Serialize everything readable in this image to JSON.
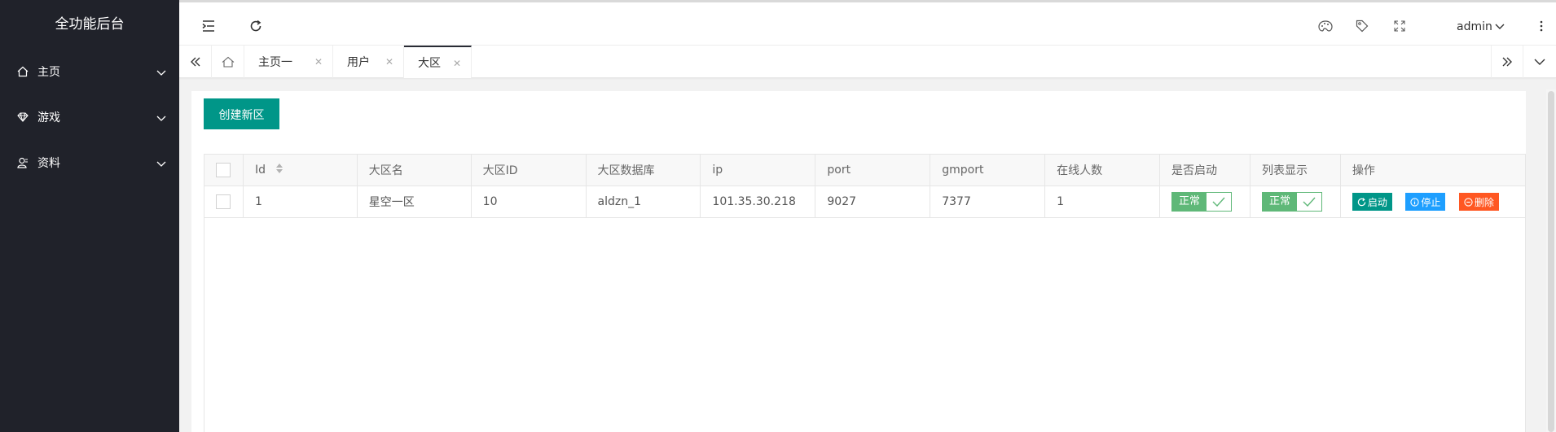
{
  "app": {
    "title": "全功能后台"
  },
  "sidebar": {
    "items": [
      {
        "label": "主页",
        "icon": "home-icon"
      },
      {
        "label": "游戏",
        "icon": "diamond-icon"
      },
      {
        "label": "资料",
        "icon": "user-icon"
      }
    ]
  },
  "header": {
    "user": "admin",
    "icons": [
      "menu-fold-icon",
      "refresh-icon",
      "theme-icon",
      "tag-icon",
      "fullscreen-icon",
      "more-icon"
    ]
  },
  "tabs": {
    "items": [
      {
        "label": "主页一",
        "active": false
      },
      {
        "label": "用户",
        "active": false
      },
      {
        "label": "大区",
        "active": true
      }
    ]
  },
  "toolbar": {
    "create_label": "创建新区"
  },
  "table": {
    "headers": [
      "Id",
      "大区名",
      "大区ID",
      "大区数据库",
      "ip",
      "port",
      "gmport",
      "在线人数",
      "是否启动",
      "列表显示",
      "操作"
    ],
    "rows": [
      {
        "id": "1",
        "name": "星空一区",
        "zone_id": "10",
        "database": "aldzn_1",
        "ip": "101.35.30.218",
        "port": "9027",
        "gmport": "7377",
        "online": "1",
        "enabled_label": "正常",
        "display_label": "正常"
      }
    ],
    "actions": {
      "start_label": "启动",
      "stop_label": "停止",
      "delete_label": "删除"
    }
  },
  "colors": {
    "sidebar_bg": "#20222a",
    "primary": "#009688",
    "switch_on": "#5FB878",
    "start_btn": "#009688",
    "stop_btn": "#1E9FFF",
    "delete_btn": "#FF5722"
  }
}
